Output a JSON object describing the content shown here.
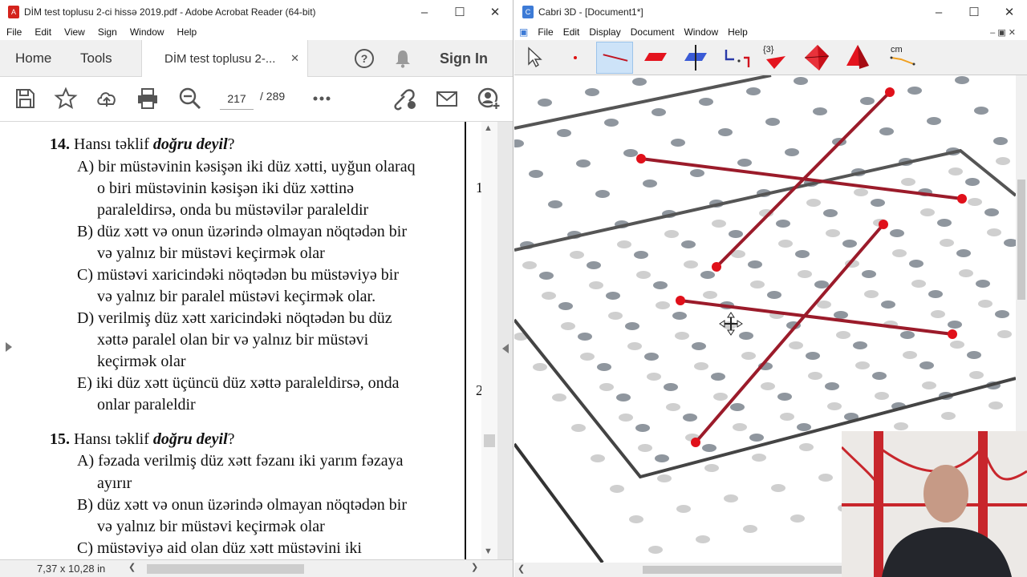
{
  "acrobat": {
    "window_title": "DİM test toplusu 2-ci hissə 2019.pdf - Adobe Acrobat Reader (64-bit)",
    "menu": [
      "File",
      "Edit",
      "View",
      "Sign",
      "Window",
      "Help"
    ],
    "tabs": {
      "home": "Home",
      "tools": "Tools",
      "doc": "DİM test toplusu 2-..."
    },
    "sign_in": "Sign In",
    "page_current": "217",
    "page_total": "/  289",
    "status_size": "7,37 x 10,28 in",
    "icons": [
      "save-icon",
      "bookmark-star-icon",
      "upload-icon",
      "print-icon",
      "zoom-out-icon",
      "more-icon",
      "share-link-icon",
      "mail-icon",
      "add-user-icon",
      "help-icon",
      "bell-icon"
    ]
  },
  "document": {
    "q14": {
      "num": "14.",
      "lead": "Hansı təklif ",
      "emph": "doğru deyil",
      "tail": "?",
      "lines": [
        "A) bir müstəvinin kəsişən iki düz xətti, uyğun olaraq",
        "o biri müstəvinin kəsişən iki düz xəttinə",
        "paraleldirsə, onda bu müstəvilər paraleldir",
        "B) düz xətt və onun üzərində olmayan nöqtədən bir",
        "və yalnız bir müstəvi keçirmək olar",
        "C) müstəvi xaricindəki nöqtədən bu müstəviyə bir",
        "və yalnız bir paralel müstəvi keçirmək olar.",
        "D) verilmiş düz xətt xaricindəki  nöqtədən bu düz",
        "xəttə paralel olan bir və yalnız bir müstəvi",
        "keçirmək olar",
        "E) iki düz xətt üçüncü düz xəttə paraleldirsə, onda",
        "onlar paraleldir"
      ]
    },
    "q15": {
      "num": "15.",
      "lead": "Hansı təklif ",
      "emph": "doğru deyil",
      "tail": "?",
      "lines": [
        "A) fəzada verilmiş düz xətt fəzanı iki yarım fəzaya",
        "ayırır",
        "B) düz xətt və onun üzərində olmayan nöqtədən bir",
        "və yalnız bir müstəvi keçirmək olar",
        "C) müstəviyə aid olan düz xətt müstəvini iki"
      ]
    },
    "margin_marks": [
      "1",
      "2"
    ]
  },
  "cabri": {
    "window_title": "Cabri 3D - [Document1*]",
    "menu": [
      "File",
      "Edit",
      "Display",
      "Document",
      "Window",
      "Help"
    ],
    "tool_label_braces": "{3}",
    "tool_label_cm": "cm",
    "tools": [
      "pointer-tool-icon",
      "point-tool-icon",
      "line-tool-icon",
      "plane-tool-icon",
      "perpendicular-tool-icon",
      "transform-tool-icon",
      "triangle-tool-icon",
      "polyhedron-tool-icon",
      "pyramid-tool-icon",
      "measure-tool-icon"
    ],
    "line_color": "#9b1b2a",
    "point_color": "#e0101a"
  }
}
